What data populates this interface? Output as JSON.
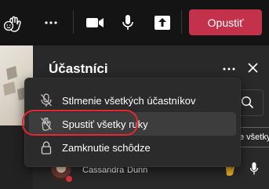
{
  "toolbar": {
    "leave_label": "Opustiť",
    "icons": [
      "raise-hand-icon",
      "more-icon",
      "camera-icon",
      "microphone-icon",
      "share-icon"
    ]
  },
  "panel": {
    "title": "Účastníci",
    "partial_button_label": "e všetky"
  },
  "menu": {
    "items": [
      {
        "label": "Stlmenie všetkých účastníkov",
        "icon": "mute-mic-icon"
      },
      {
        "label": "Spustiť všetky ruky",
        "icon": "lower-hand-icon"
      },
      {
        "label": "Zamknutie schôdze",
        "icon": "lock-icon"
      }
    ]
  },
  "participant": {
    "first_name": "Cassandra",
    "last_name": "Dunn",
    "presence_color": "#d13438"
  },
  "colors": {
    "accent_leave": "#c4314b",
    "highlight_ring": "#e8262d",
    "hand_icon": "#f2b32c"
  }
}
